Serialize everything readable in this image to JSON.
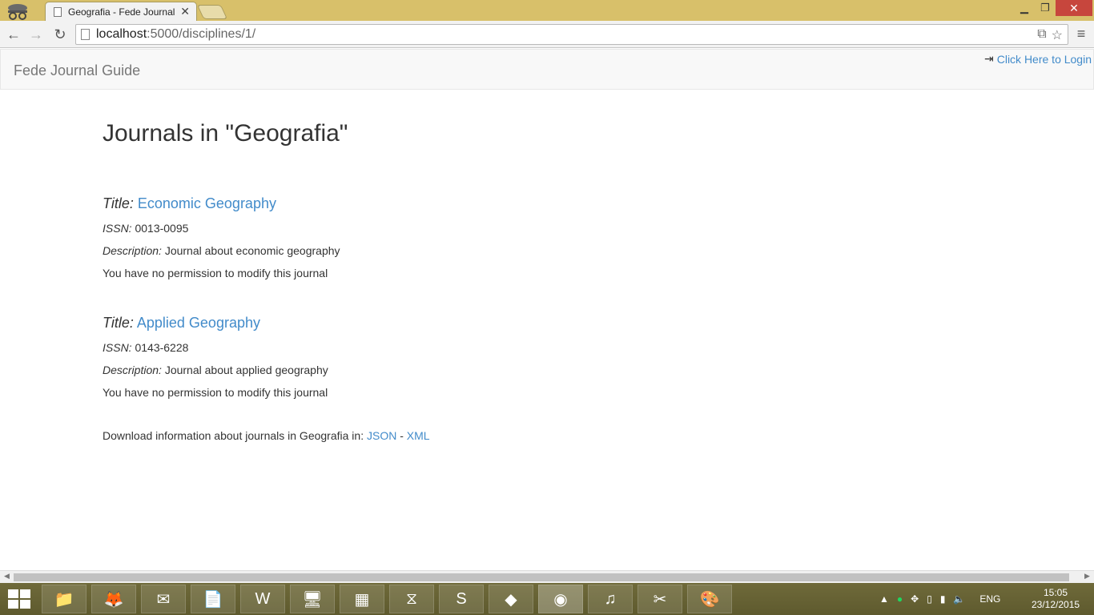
{
  "browser": {
    "tab_title": "Geografia - Fede Journal Guide",
    "url_host": "localhost",
    "url_path": ":5000/disciplines/1/"
  },
  "navbar": {
    "brand": "Fede Journal Guide",
    "login_label": "Click Here to Login"
  },
  "main": {
    "heading": "Journals in \"Geografia\"",
    "labels": {
      "title": "Title:",
      "issn": "ISSN:",
      "description": "Description:"
    },
    "journals": [
      {
        "title": "Economic Geography",
        "issn": "0013-0095",
        "description": "Journal about economic geography",
        "permission": "You have no permission to modify this journal"
      },
      {
        "title": "Applied Geography",
        "issn": "0143-6228",
        "description": "Journal about applied geography",
        "permission": "You have no permission to modify this journal"
      }
    ],
    "download_text": "Download information about journals in Geografia in:",
    "download_json": "JSON",
    "download_sep": "-",
    "download_xml": "XML"
  },
  "taskbar": {
    "tray_language": "ENG",
    "time": "15:05",
    "date": "23/12/2015"
  }
}
